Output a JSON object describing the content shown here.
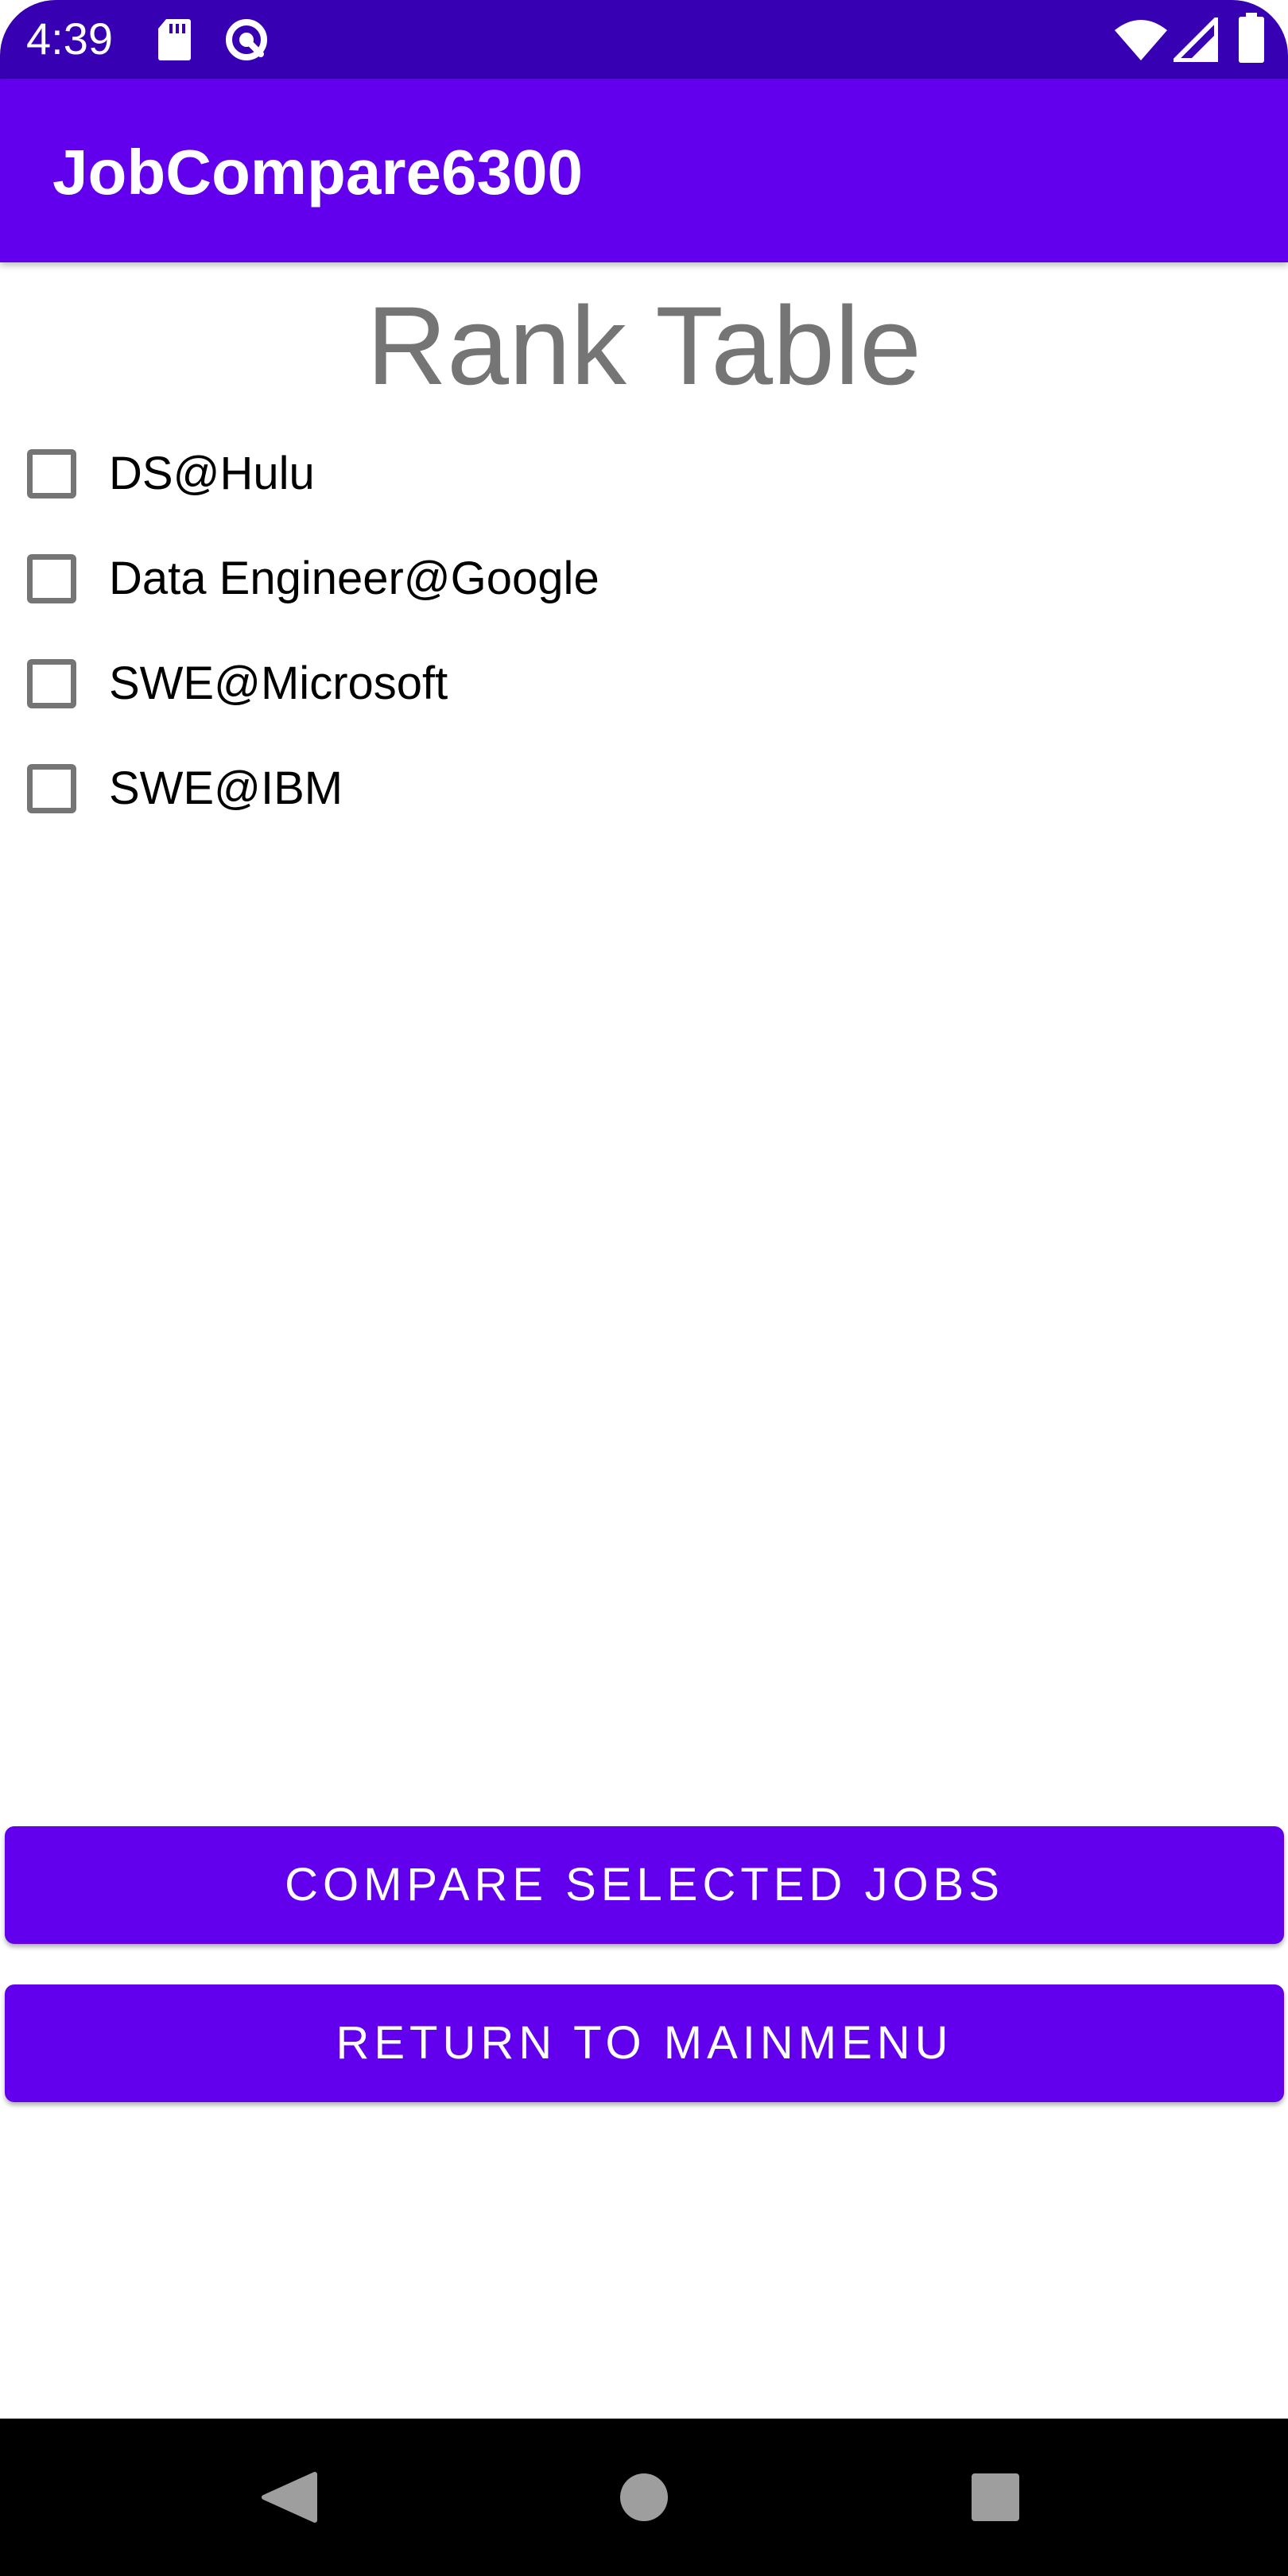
{
  "status_bar": {
    "time": "4:39",
    "icons": [
      "sd-card-icon",
      "sync-icon",
      "wifi-icon",
      "signal-icon",
      "battery-icon"
    ]
  },
  "app_bar": {
    "title": "JobCompare6300"
  },
  "page": {
    "title": "Rank Table",
    "jobs": [
      {
        "label": "DS@Hulu",
        "checked": false
      },
      {
        "label": "Data Engineer@Google",
        "checked": false
      },
      {
        "label": "SWE@Microsoft",
        "checked": false
      },
      {
        "label": "SWE@IBM",
        "checked": false
      }
    ]
  },
  "buttons": {
    "compare_label": "COMPARE SELECTED JOBS",
    "return_label": "RETURN TO MAINMENU"
  },
  "nav_bar": {
    "icons": [
      "back-icon",
      "home-icon",
      "recents-icon"
    ]
  },
  "colors": {
    "status_bar": "#3700b3",
    "primary": "#6200ee",
    "title_gray": "#757575"
  }
}
